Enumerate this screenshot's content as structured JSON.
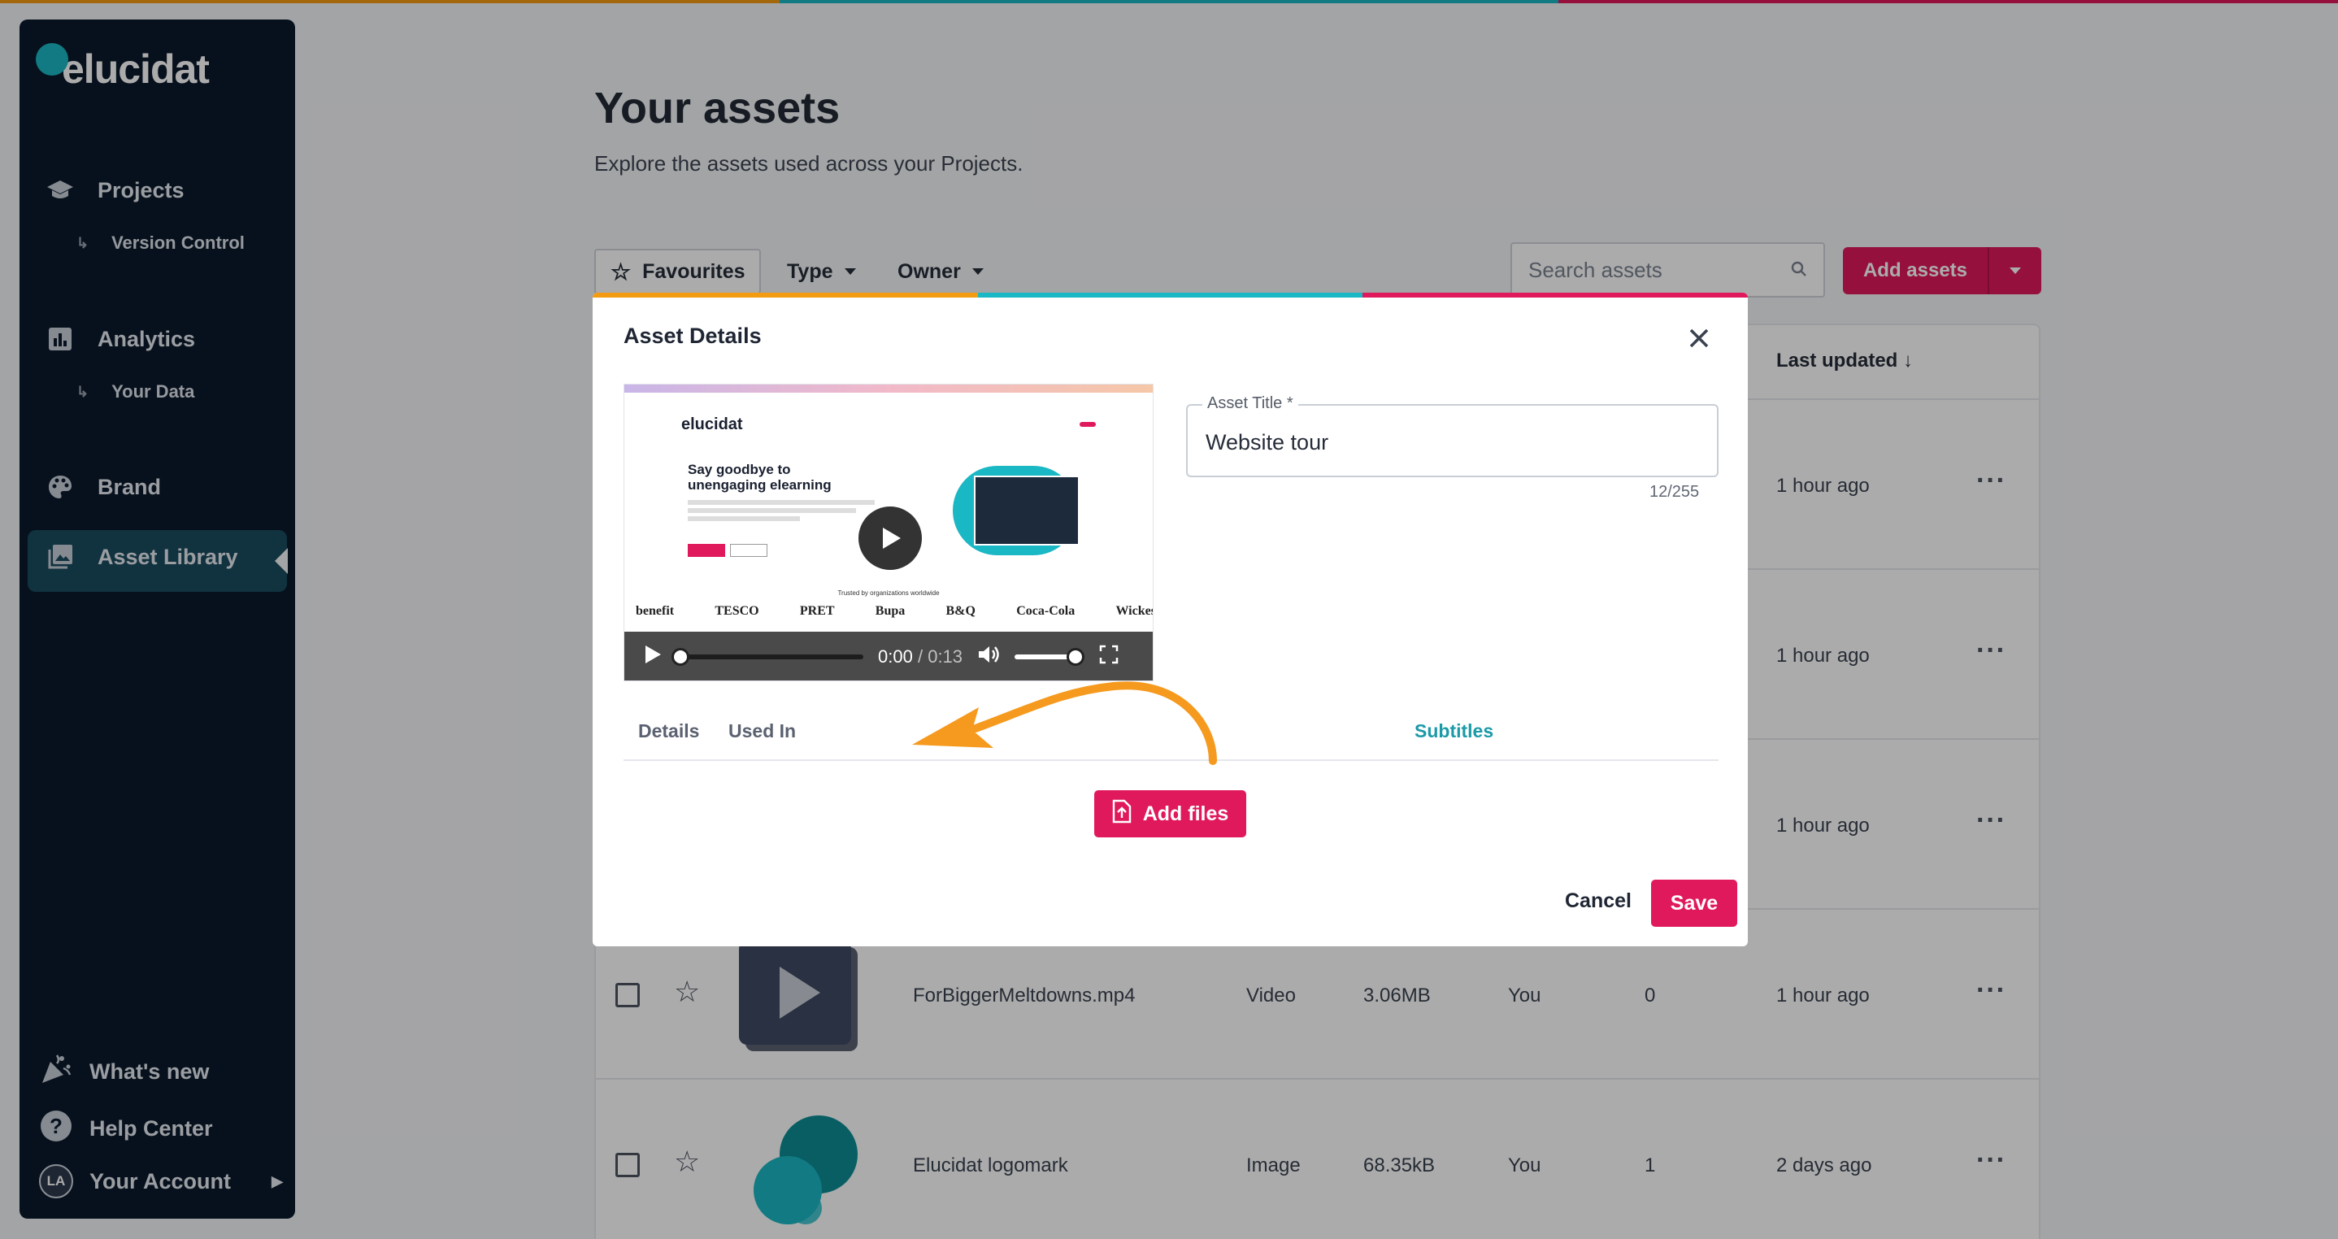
{
  "colors": {
    "sidebar_bg": "#0b1a2c",
    "accent_pink": "#e0195c",
    "accent_teal": "#1b9aa8",
    "stripe_orange": "#f39c12",
    "stripe_blue": "#1ab7c4",
    "stripe_pink": "#e0195c",
    "annotation_arrow": "#f59a1e"
  },
  "sidebar": {
    "logo": "elucidat",
    "items": [
      {
        "label": "Projects",
        "icon": "graduation-cap-icon"
      },
      {
        "label": "Version Control",
        "icon": "subitem-arrow-icon"
      },
      {
        "label": "Analytics",
        "icon": "bar-chart-icon"
      },
      {
        "label": "Your Data",
        "icon": "subitem-arrow-icon"
      },
      {
        "label": "Brand",
        "icon": "palette-icon"
      },
      {
        "label": "Asset Library",
        "icon": "image-gallery-icon",
        "active": true
      }
    ],
    "bottom": {
      "whats_new": "What's new",
      "help_center": "Help Center",
      "account": "Your Account",
      "avatar_initials": "LA"
    }
  },
  "page": {
    "title": "Your assets",
    "subtitle": "Explore the assets used across your Projects.",
    "filters": {
      "favourites": "Favourites",
      "type": "Type",
      "owner": "Owner"
    },
    "search_placeholder": "Search assets",
    "add_assets": "Add assets",
    "column_last_updated": "Last updated",
    "rows": [
      {
        "name": "",
        "type": "",
        "size": "",
        "owner": "",
        "used": "",
        "updated": "1 hour ago"
      },
      {
        "name": "",
        "type": "",
        "size": "",
        "owner": "",
        "used": "",
        "updated": "1 hour ago"
      },
      {
        "name": "",
        "type": "",
        "size": "",
        "owner": "",
        "used": "",
        "updated": "1 hour ago"
      },
      {
        "name": "ForBiggerMeltdowns.mp4",
        "type": "Video",
        "size": "3.06MB",
        "owner": "You",
        "used": "0",
        "updated": "1 hour ago"
      },
      {
        "name": "Elucidat logomark",
        "type": "Image",
        "size": "68.35kB",
        "owner": "You",
        "used": "1",
        "updated": "2 days ago"
      }
    ]
  },
  "modal": {
    "title": "Asset Details",
    "video": {
      "time_current": "0:00",
      "time_separator": "/",
      "time_total": "0:13",
      "progress": 0,
      "volume": 0.85,
      "preview": {
        "logo": "elucidat",
        "headline_1": "Say goodbye to",
        "headline_2": "unengaging elearning",
        "trusted": "Trusted by organizations worldwide",
        "brand_logos": [
          "benefit",
          "TESCO",
          "",
          "",
          "PRET",
          "Bupa",
          "B&Q",
          "Coca-Cola",
          "Wickes"
        ]
      }
    },
    "field": {
      "label": "Asset Title *",
      "value": "Website tour",
      "count": "12/255"
    },
    "tabs": [
      "Details",
      "Used In",
      "Subtitles"
    ],
    "active_tab": "Subtitles",
    "add_files": "Add files",
    "cancel": "Cancel",
    "save": "Save"
  }
}
